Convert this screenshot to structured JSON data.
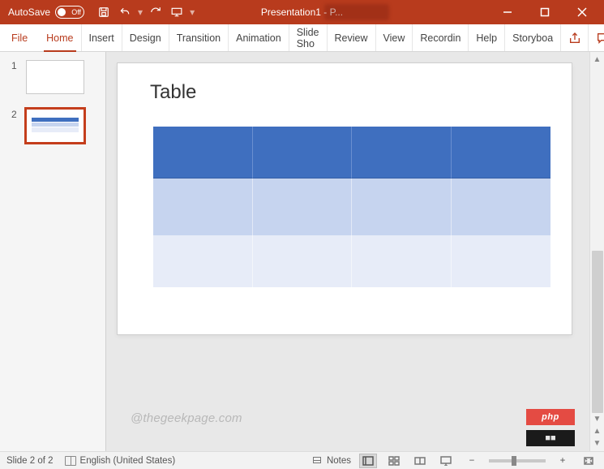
{
  "titlebar": {
    "autosave_label": "AutoSave",
    "autosave_state": "Off",
    "document_title": "Presentation1 - P..."
  },
  "ribbon": {
    "tabs": {
      "file": "File",
      "home": "Home",
      "insert": "Insert",
      "design": "Design",
      "transitions": "Transition",
      "animations": "Animation",
      "slideshow": "Slide Sho",
      "review": "Review",
      "view": "View",
      "recording": "Recordin",
      "help": "Help",
      "storyboard": "Storyboa"
    }
  },
  "thumbnails": {
    "slide1_num": "1",
    "slide2_num": "2"
  },
  "slide": {
    "title": "Table"
  },
  "watermark": "@thegeekpage.com",
  "badge_php": "php",
  "statusbar": {
    "slide_counter": "Slide 2 of 2",
    "language": "English (United States)",
    "notes_label": "Notes",
    "zoom_minus": "−",
    "zoom_plus": "+"
  }
}
